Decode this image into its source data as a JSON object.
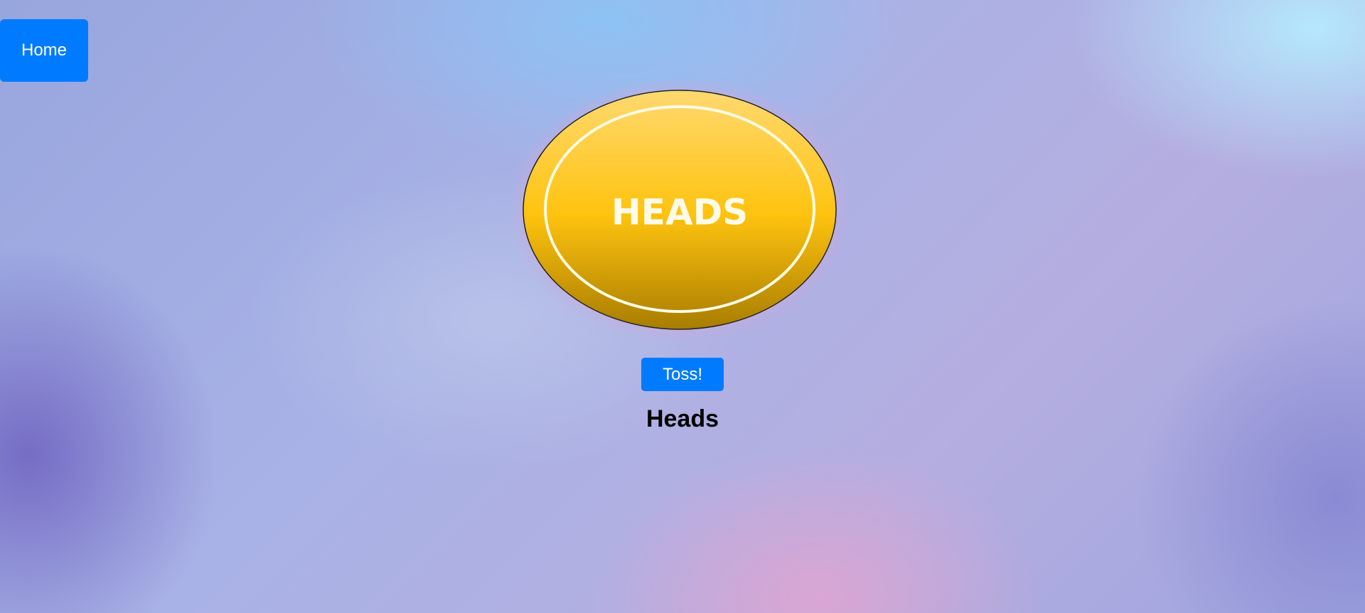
{
  "nav": {
    "home_label": "Home"
  },
  "coin": {
    "face_text": "HEADS",
    "icon": "coin-heads-icon"
  },
  "controls": {
    "toss_label": "Toss!"
  },
  "result": {
    "text": "Heads"
  },
  "colors": {
    "button": "#007bff",
    "coin_top": "#ffd970",
    "coin_mid": "#ffc30f",
    "coin_bottom": "#a87d00"
  }
}
